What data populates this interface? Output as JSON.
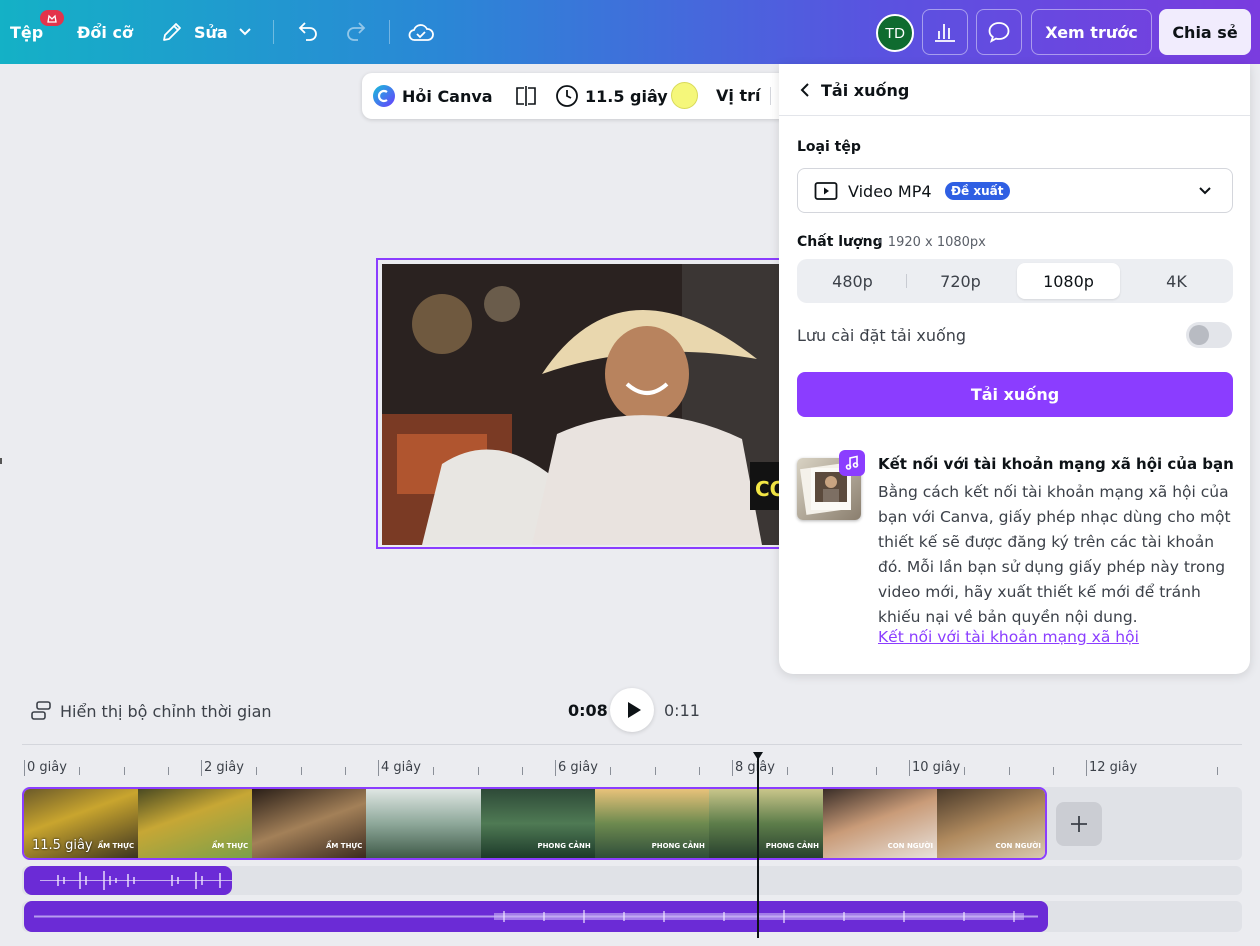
{
  "topbar": {
    "file": "Tệp",
    "resize": "Đổi cỡ",
    "edit": "Sửa",
    "avatar": "TD",
    "preview": "Xem trước",
    "share": "Chia sẻ",
    "gradient": [
      "#14b1c6",
      "#2a87d6",
      "#5a52e0",
      "#7a3cdf"
    ]
  },
  "context_toolbar": {
    "ask_canva": "Hỏi Canva",
    "duration": "11.5 giây",
    "position": "Vị trí"
  },
  "canvas": {
    "overlay_text": "CO"
  },
  "download_panel": {
    "title": "Tải xuống",
    "file_type_label": "Loại tệp",
    "file_type_value": "Video MP4",
    "file_type_tag": "Đề xuất",
    "quality_label": "Chất lượng",
    "quality_dims": "• 1920 x 1080px",
    "quality_options": [
      "480p",
      "720p",
      "1080p",
      "4K"
    ],
    "quality_selected": "1080p",
    "save_settings_label": "Lưu cài đặt tải xuống",
    "save_settings_on": false,
    "download_button": "Tải xuống",
    "social_title": "Kết nối với tài khoản mạng xã hội của bạn",
    "social_body": "Bằng cách kết nối tài khoản mạng xã hội của bạn với Canva, giấy phép nhạc dùng cho một thiết kế sẽ được đăng ký trên các tài khoản đó. Mỗi lần bạn sử dụng giấy phép này trong video mới, hãy xuất thiết kế mới để tránh khiếu nại về bản quyền nội dung.",
    "social_link": "Kết nối với tài khoản mạng xã hội",
    "accent": "#8b3dff"
  },
  "playback": {
    "timing_toggle": "Hiển thị bộ chỉnh thời gian",
    "current": "0:08",
    "total": "0:11"
  },
  "timeline": {
    "ruler": [
      "0 giây",
      "2 giây",
      "4 giây",
      "6 giây",
      "8 giây",
      "10 giây",
      "12 giây"
    ],
    "clip_length": "11.5 giây",
    "clip_captions": [
      "ẨM THỰC",
      "ẨM THỰC",
      "ẨM THỰC",
      "",
      "PHONG CẢNH",
      "PHONG CẢNH",
      "PHONG CẢNH",
      "CON NGƯỜI",
      "CON NGƯỜI"
    ],
    "playhead_seconds": 8
  }
}
